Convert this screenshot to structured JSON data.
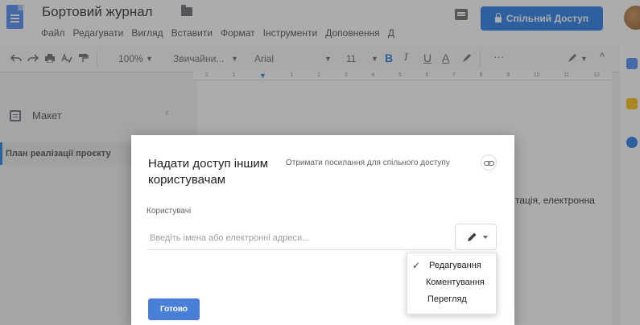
{
  "header": {
    "doc_title": "Бортовий журнал",
    "menus": [
      "Файл",
      "Редагувати",
      "Вигляд",
      "Вставити",
      "Формат",
      "Інструменти",
      "Доповнення",
      "Д"
    ],
    "share_label": "Спільний Доступ"
  },
  "toolbar": {
    "zoom": "100%",
    "style": "Звичайни...",
    "font": "Arial",
    "font_size": "11",
    "more": "···",
    "ruler_marks": [
      "2",
      "1",
      "1",
      "2",
      "3",
      "4",
      "5",
      "6",
      "7",
      "8",
      "9",
      "10",
      "11",
      "12"
    ]
  },
  "outline": {
    "title": "Макет",
    "item": "План реалізації проєкту"
  },
  "document": {
    "visible_text": "тація, електронна"
  },
  "dialog": {
    "title": "Надати доступ іншим користувачам",
    "get_link": "Отримати посилання для спільного доступу",
    "users_label": "Користувачі",
    "input_placeholder": "Введіть імена або електронні адреси...",
    "done_label": "Готово",
    "permission_options": [
      "Редагування",
      "Коментування",
      "Перегляд"
    ],
    "selected_permission": "Редагування"
  },
  "colors": {
    "accent": "#1a73e8",
    "doc_blue": "#4285f4",
    "done_button": "#4a7fd8"
  }
}
